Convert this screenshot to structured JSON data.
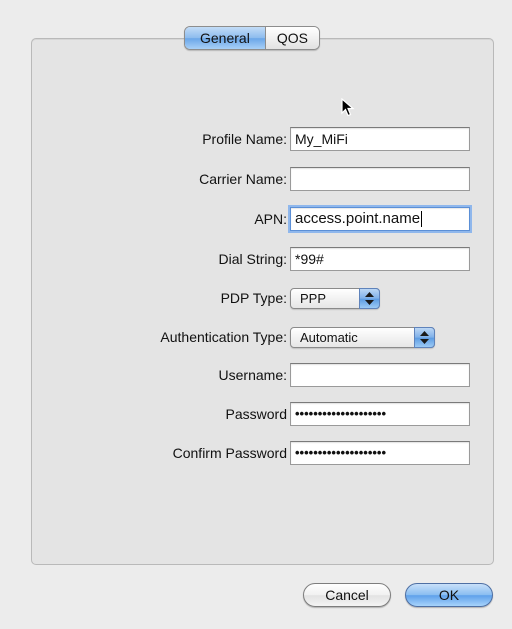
{
  "tabs": [
    {
      "label": "General",
      "selected": true
    },
    {
      "label": "QOS",
      "selected": false
    }
  ],
  "form": {
    "profile_name": {
      "label": "Profile Name:",
      "value": "My_MiFi"
    },
    "carrier_name": {
      "label": "Carrier Name:",
      "value": ""
    },
    "apn": {
      "label": "APN:",
      "value": "access.point.name"
    },
    "dial_string": {
      "label": "Dial String:",
      "value": "*99#"
    },
    "pdp_type": {
      "label": "PDP Type:",
      "value": "PPP"
    },
    "auth_type": {
      "label": "Authentication Type:",
      "value": "Automatic"
    },
    "username": {
      "label": "Username:",
      "value": ""
    },
    "password": {
      "label": "Password",
      "value": "••••••••••••••••••••"
    },
    "confirm_password": {
      "label": "Confirm Password",
      "value": "••••••••••••••••••••"
    }
  },
  "buttons": {
    "cancel": "Cancel",
    "ok": "OK"
  },
  "colors": {
    "window_bg": "#ececec",
    "accent": "#6aa6e8",
    "focus_ring": "#8fb7ec"
  },
  "icons": {
    "cursor": "arrow-cursor-icon",
    "popup_arrows": "up-down-arrows-icon"
  }
}
